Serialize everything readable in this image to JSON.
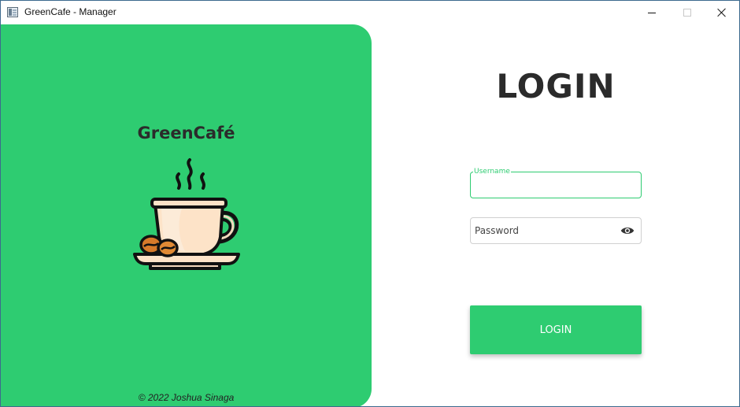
{
  "window": {
    "title": "GreenCafe - Manager",
    "controls": [
      "minimize",
      "maximize",
      "close"
    ]
  },
  "brand": {
    "name": "GreenCafé",
    "illustration": "coffee-cup-illustration",
    "copyright": "© 2022 Joshua Sinaga",
    "color": "#2ecc71"
  },
  "form": {
    "heading": "LOGIN",
    "username": {
      "label": "Username",
      "value": "",
      "placeholder": ""
    },
    "password": {
      "value": "",
      "placeholder": "Password",
      "icon": "eye-icon"
    },
    "submit_label": "LOGIN"
  },
  "colors": {
    "accent": "#2ecc71",
    "heading": "#2b2b2b",
    "field_border": "#d0d0d0"
  }
}
